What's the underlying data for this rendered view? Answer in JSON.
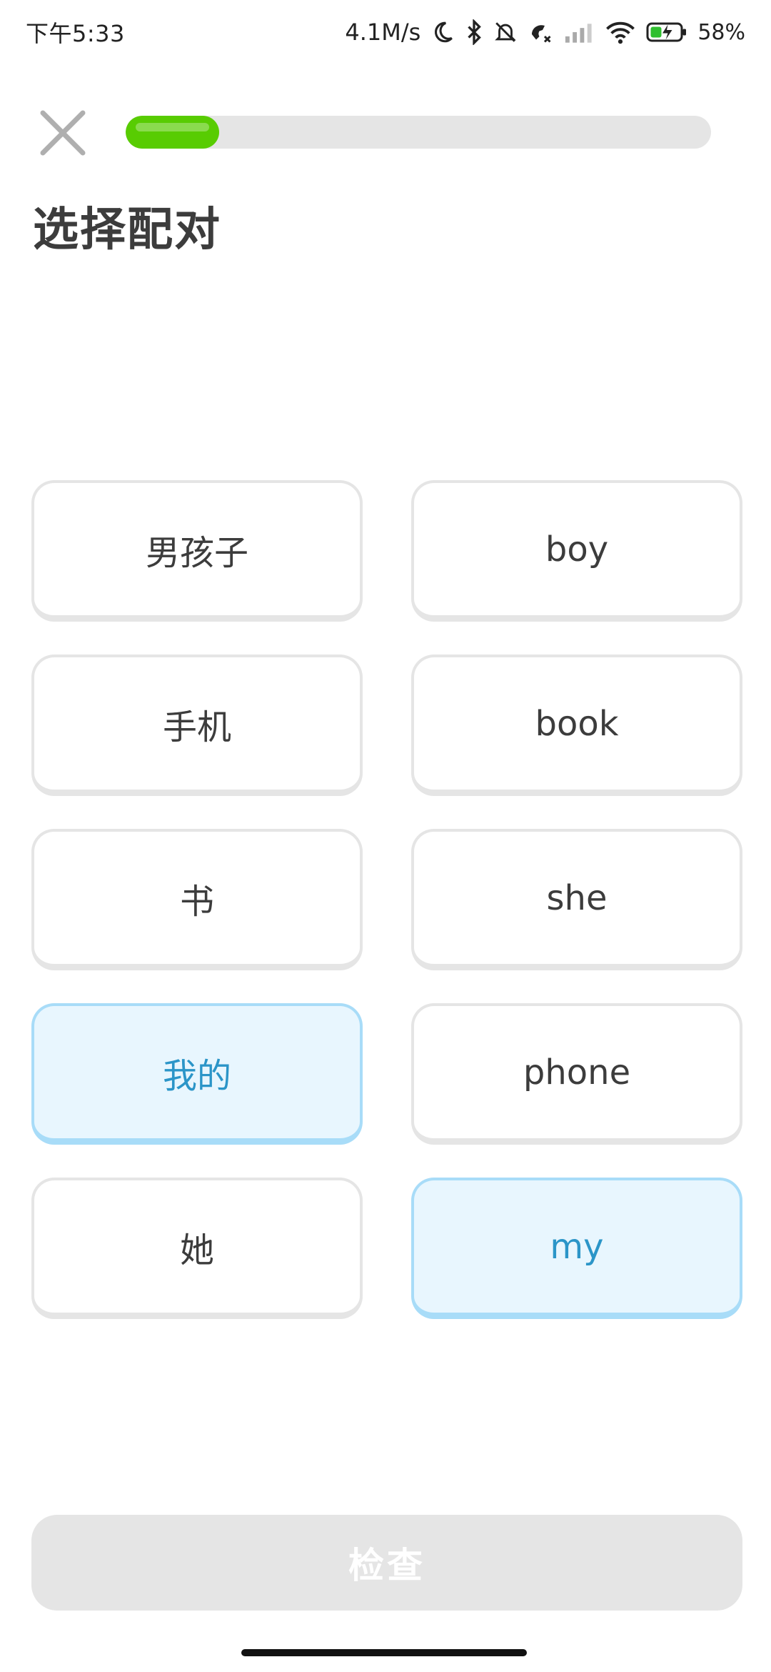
{
  "status_bar": {
    "time": "下午5:33",
    "network_speed": "4.1M/s",
    "battery": "58%",
    "icons": [
      "moon-icon",
      "bluetooth-icon",
      "bell-off-icon",
      "call-icon",
      "signal-icon",
      "wifi-icon",
      "battery-charging-icon"
    ]
  },
  "header": {
    "close_icon": "close-icon",
    "progress": 0.16,
    "progress_color": "#58cc02"
  },
  "title": "选择配对",
  "tiles": [
    {
      "left": "男孩子",
      "right": "boy"
    },
    {
      "left": "手机",
      "right": "book"
    },
    {
      "left": "书",
      "right": "she"
    },
    {
      "left": "我的",
      "right": "phone"
    },
    {
      "left": "她",
      "right": "my"
    }
  ],
  "selected": {
    "left": "我的",
    "right": "my"
  },
  "colors": {
    "selected_bg": "#e8f6fe",
    "selected_border": "#a8dcf8",
    "selected_text": "#2b95c8",
    "tile_border": "#e5e5e5"
  },
  "check_button": {
    "label": "检查",
    "enabled": false
  }
}
